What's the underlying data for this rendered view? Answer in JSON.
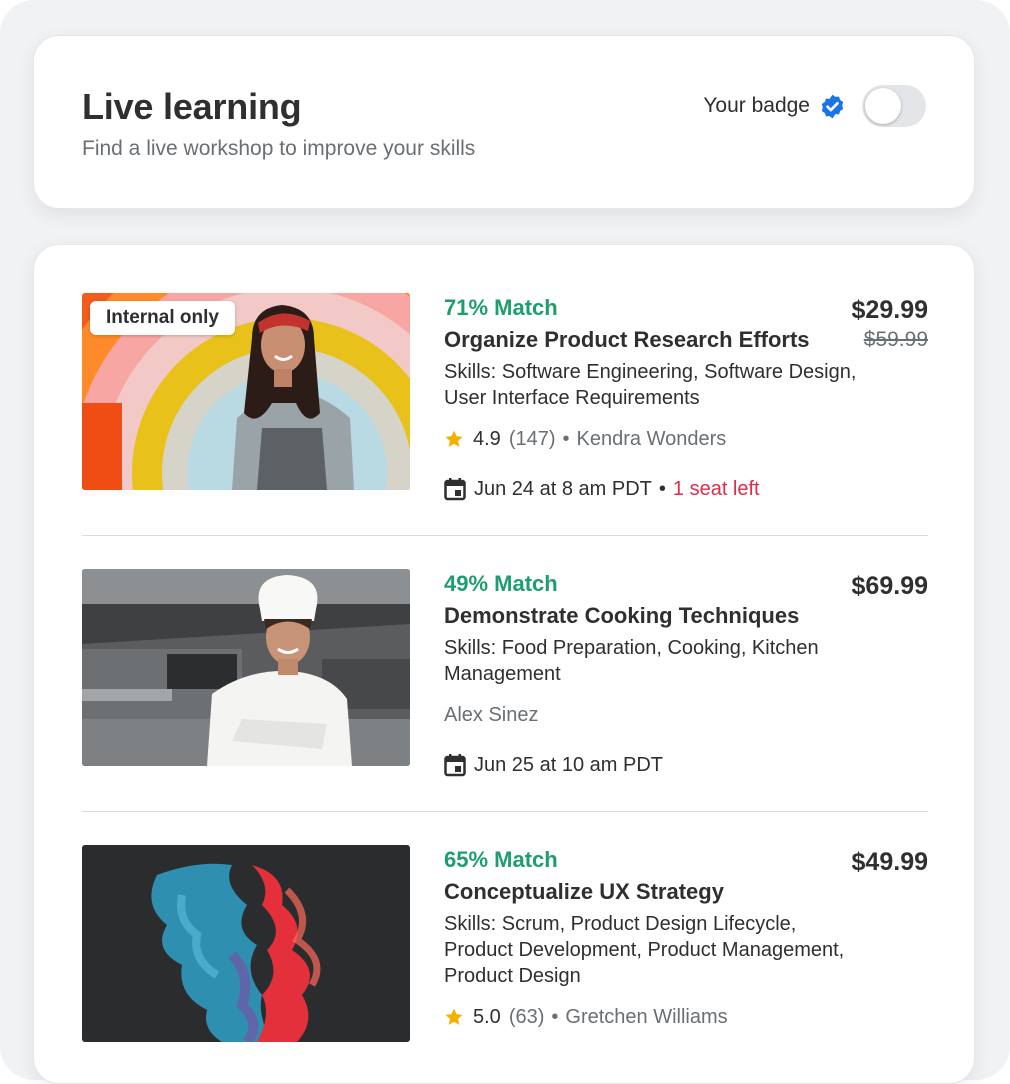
{
  "header": {
    "title": "Live learning",
    "subtitle": "Find a live workshop to improve your skills",
    "badge_label": "Your badge",
    "badge_toggle_on": false
  },
  "colors": {
    "match": "#1e9e6c",
    "seats_warning": "#e02c48",
    "verified": "#1a73e8",
    "star": "#f3b100"
  },
  "courses": [
    {
      "tag": "Internal only",
      "match": "71% Match",
      "title": "Organize Product Research Efforts",
      "skills": "Skills: Software Engineering, Software Design, User Interface Requirements",
      "rating": "4.9",
      "rating_count": "(147)",
      "instructor": "Kendra Wonders",
      "date": "Jun 24 at 8 am PDT",
      "seats": "1 seat left",
      "price": "$29.99",
      "old_price": "$59.99"
    },
    {
      "match": "49% Match",
      "title": "Demonstrate Cooking Techniques",
      "skills": "Skills: Food Preparation, Cooking, Kitchen Management",
      "instructor": "Alex Sinez",
      "date": "Jun 25 at 10 am PDT",
      "price": "$69.99"
    },
    {
      "match": "65% Match",
      "title": "Conceptualize UX Strategy",
      "skills": "Skills: Scrum, Product Design Lifecycle, Product Development, Product Management, Product Design",
      "rating": "5.0",
      "rating_count": "(63)",
      "instructor": "Gretchen Williams",
      "price": "$49.99"
    }
  ]
}
